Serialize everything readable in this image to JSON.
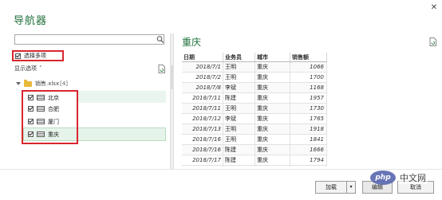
{
  "window": {
    "title": "导航器",
    "close_glyph": "✕"
  },
  "left": {
    "search_placeholder": "",
    "multi_select_label": "选择多项",
    "display_options_label": "显示选项",
    "display_options_caret": "˅",
    "root": {
      "name": "销售.xlsx",
      "count": "[4]"
    },
    "items": [
      {
        "label": "北京",
        "checked": true
      },
      {
        "label": "合肥",
        "checked": true
      },
      {
        "label": "厦门",
        "checked": true
      },
      {
        "label": "重庆",
        "checked": true
      }
    ]
  },
  "preview": {
    "title": "重庆",
    "columns": [
      "日期",
      "业务员",
      "城市",
      "销售额"
    ],
    "rows": [
      [
        "2018/7/1",
        "王明",
        "重庆",
        "1066"
      ],
      [
        "2018/7/2",
        "王明",
        "重庆",
        "1700"
      ],
      [
        "2018/7/8",
        "李斌",
        "重庆",
        "1168"
      ],
      [
        "2018/7/11",
        "陈建",
        "重庆",
        "1957"
      ],
      [
        "2018/7/11",
        "王明",
        "重庆",
        "1730"
      ],
      [
        "2018/7/12",
        "李斌",
        "重庆",
        "1765"
      ],
      [
        "2018/7/13",
        "王明",
        "重庆",
        "1918"
      ],
      [
        "2018/7/16",
        "王明",
        "重庆",
        "1841"
      ],
      [
        "2018/7/16",
        "陈建",
        "重庆",
        "1666"
      ],
      [
        "2018/7/17",
        "陈建",
        "重庆",
        "1794"
      ],
      [
        "2018/7/18",
        "陈建",
        "重庆",
        "1365"
      ]
    ]
  },
  "buttons": {
    "load": "加载",
    "dropdown": "▾",
    "edit": "编辑",
    "cancel": "取消"
  },
  "watermark": {
    "logo": "php",
    "text": "中文网"
  },
  "colors": {
    "accent_green": "#1e6f3a",
    "highlight_red": "#d8262e"
  }
}
